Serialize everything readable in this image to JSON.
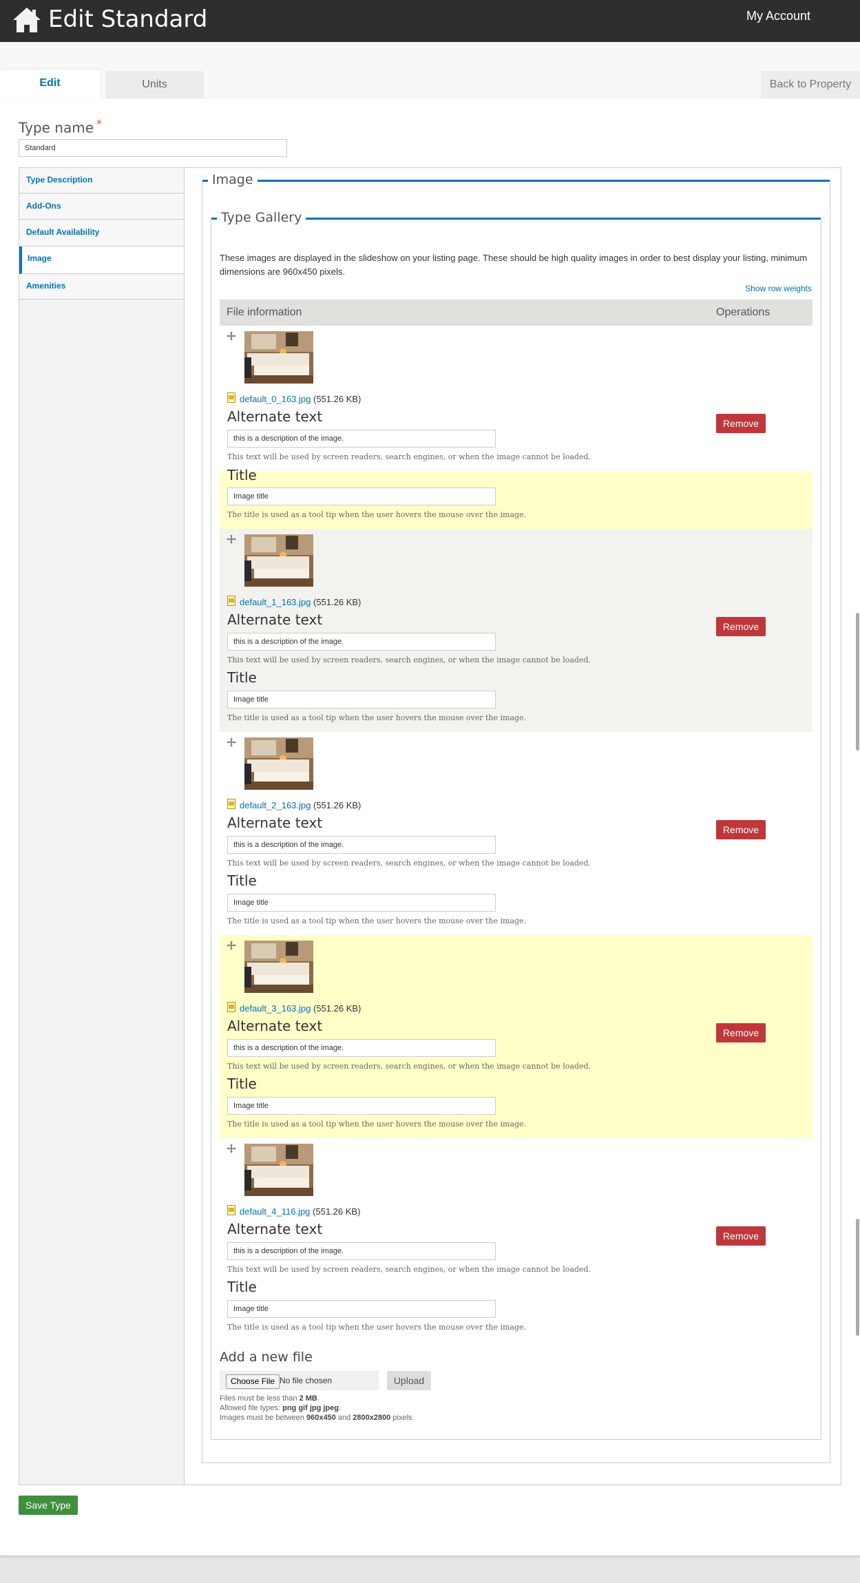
{
  "header": {
    "title": "Edit Standard",
    "my_account": "My Account"
  },
  "tabs": {
    "edit": "Edit",
    "units": "Units",
    "back": "Back to Property"
  },
  "type_name": {
    "label": "Type name",
    "required_mark": "*",
    "value": "Standard"
  },
  "vertical_tabs": [
    {
      "label": "Type Description",
      "active": false
    },
    {
      "label": "Add-Ons",
      "active": false
    },
    {
      "label": "Default Availability",
      "active": false
    },
    {
      "label": "Image",
      "active": true
    },
    {
      "label": "Amenities",
      "active": false
    }
  ],
  "image_section": {
    "legend": "Image",
    "gallery_legend": "Type Gallery",
    "description": "These images are displayed in the slideshow on your listing page. These should be high quality images in order to best display your listing, minimum dimensions are 960x450 pixels.",
    "show_row_weights": "Show row weights",
    "columns": [
      "File information",
      "Operations"
    ],
    "alt_label": "Alternate text",
    "alt_help": "This text will be used by screen readers, search engines, or when the image cannot be loaded.",
    "title_label": "Title",
    "title_help": "The title is used as a tool tip when the user hovers the mouse over the image.",
    "remove_label": "Remove",
    "rows": [
      {
        "filename": "default_0_163.jpg",
        "size": "(551.26 KB)",
        "alt": "this is a description of the image.",
        "title": "Image title"
      },
      {
        "filename": "default_1_163.jpg",
        "size": "(551.26 KB)",
        "alt": "this is a description of the image.",
        "title": "Image title"
      },
      {
        "filename": "default_2_163.jpg",
        "size": "(551.26 KB)",
        "alt": "this is a description of the image.",
        "title": "Image title"
      },
      {
        "filename": "default_3_163.jpg",
        "size": "(551.26 KB)",
        "alt": "this is a description of the image.",
        "title": "Image title"
      },
      {
        "filename": "default_4_116.jpg",
        "size": "(551.26 KB)",
        "alt": "this is a description of the image.",
        "title": "Image title"
      }
    ],
    "add_new_file": "Add a new file",
    "choose_file": "Choose File",
    "no_file": "No file chosen",
    "upload": "Upload",
    "limits": {
      "size_prefix": "Files must be less than",
      "size_value": "2 MB",
      "types_prefix": "Allowed file types:",
      "types_value": "png gif jpg jpeg",
      "dims_prefix": "Images must be between",
      "dims_min": "960x450",
      "dims_and": "and",
      "dims_max": "2800x2800",
      "dims_suffix": "pixels."
    }
  },
  "save_button": "Save Type",
  "colors": {
    "accent": "#0074bd",
    "remove": "#c0373b",
    "save": "#3f8f3f",
    "highlight": "#ffffc8",
    "row_alt": "#f2f2ee"
  }
}
